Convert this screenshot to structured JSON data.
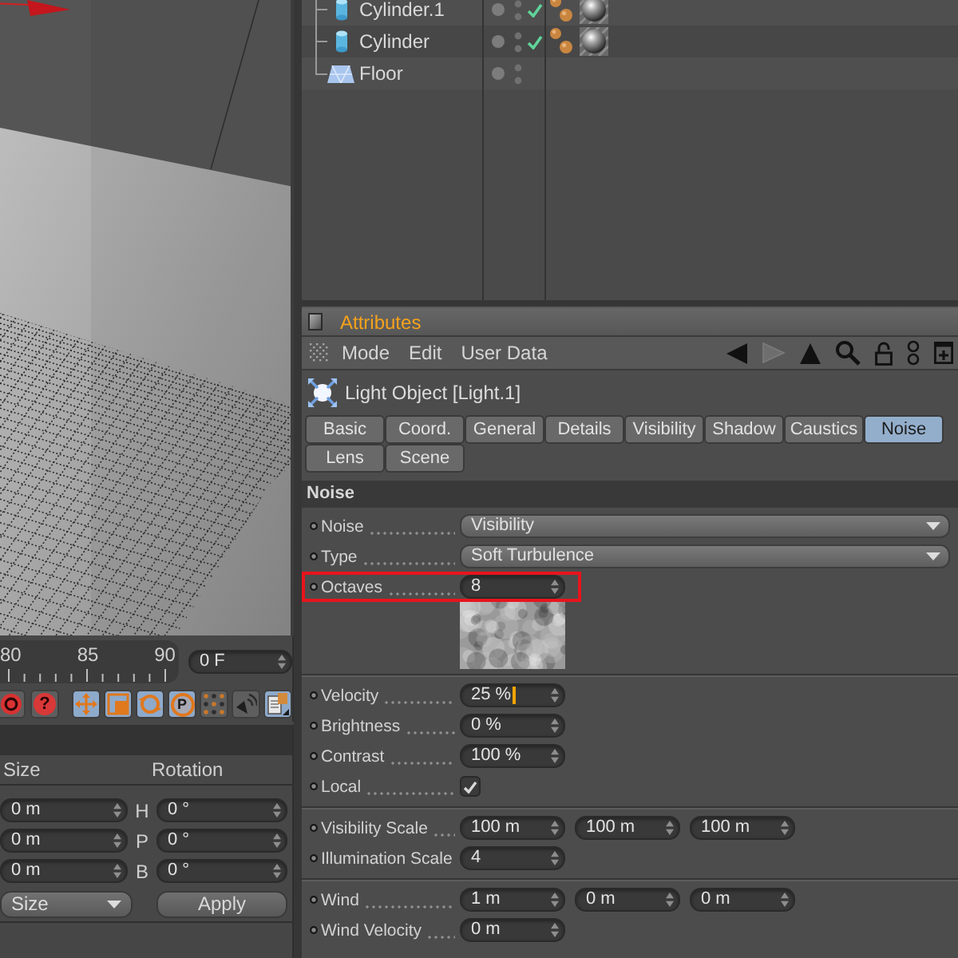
{
  "timeline": {
    "ticks": [
      "80",
      "85",
      "90"
    ],
    "frame_field": "0 F"
  },
  "toolbar": [
    {
      "kind": "ring",
      "on": false
    },
    {
      "kind": "help",
      "glyph": "?",
      "on": false
    },
    {
      "kind": "move",
      "on": true
    },
    {
      "kind": "scale",
      "on": true
    },
    {
      "kind": "rotate",
      "on": true
    },
    {
      "kind": "point",
      "glyph": "P",
      "on": true
    },
    {
      "kind": "dots",
      "on": false
    },
    {
      "kind": "speaker",
      "on": false
    },
    {
      "kind": "document",
      "on": true
    }
  ],
  "coordinates": {
    "columns": [
      "Size",
      "Rotation"
    ],
    "rows": [
      {
        "size": "0 m",
        "axis": "H",
        "rotation": "0 °"
      },
      {
        "size": "0 m",
        "axis": "P",
        "rotation": "0 °"
      },
      {
        "size": "0 m",
        "axis": "B",
        "rotation": "0 °"
      }
    ],
    "mode_dropdown": "Size",
    "apply_button": "Apply"
  },
  "object_manager": {
    "objects": [
      {
        "name": "Cylinder.1",
        "kind": "cylinder",
        "enabled": true,
        "tags": [
          {
            "kind": "balls"
          },
          {
            "kind": "material"
          }
        ]
      },
      {
        "name": "Cylinder",
        "kind": "cylinder",
        "enabled": true,
        "tags": [
          {
            "kind": "balls"
          },
          {
            "kind": "material"
          }
        ]
      },
      {
        "name": "Floor",
        "kind": "floor",
        "enabled": false
      }
    ]
  },
  "attributes": {
    "title": "Attributes",
    "menu": [
      "Mode",
      "Edit",
      "User Data"
    ],
    "nav": [
      {
        "kind": "back",
        "disabled": false
      },
      {
        "kind": "forward",
        "disabled": true
      },
      {
        "kind": "up",
        "disabled": false
      },
      {
        "kind": "search",
        "disabled": false
      },
      {
        "kind": "lock",
        "disabled": false
      },
      {
        "kind": "rings",
        "disabled": false
      },
      {
        "kind": "new-window",
        "disabled": false
      }
    ],
    "object_label": "Light Object [Light.1]",
    "tabs": [
      {
        "label": "Basic",
        "selected": false
      },
      {
        "label": "Coord.",
        "selected": false
      },
      {
        "label": "General",
        "selected": false
      },
      {
        "label": "Details",
        "selected": false
      },
      {
        "label": "Visibility",
        "selected": false
      },
      {
        "label": "Shadow",
        "selected": false
      },
      {
        "label": "Caustics",
        "selected": false
      },
      {
        "label": "Noise",
        "selected": true
      },
      {
        "label": "Lens",
        "selected": false
      },
      {
        "label": "Scene",
        "selected": false
      }
    ],
    "section": "Noise",
    "groups": [
      {
        "rows": [
          {
            "kind": "dropdown",
            "label": "Noise",
            "value": "Visibility",
            "highlighted": false
          },
          {
            "kind": "dropdown",
            "label": "Type",
            "value": "Soft Turbulence",
            "highlighted": false
          },
          {
            "kind": "number",
            "label": "Octaves",
            "value": "8",
            "highlighted": true,
            "focused": false
          },
          {
            "kind": "preview",
            "highlighted": false
          }
        ]
      },
      {
        "rows": [
          {
            "kind": "number",
            "label": "Velocity",
            "value": "25 %",
            "highlighted": false,
            "focused": true
          },
          {
            "kind": "number",
            "label": "Brightness",
            "value": "0 %",
            "highlighted": false,
            "focused": false
          },
          {
            "kind": "number",
            "label": "Contrast",
            "value": "100 %",
            "highlighted": false,
            "focused": false
          },
          {
            "kind": "checkbox",
            "label": "Local",
            "checked": true,
            "highlighted": false
          }
        ]
      },
      {
        "rows": [
          {
            "kind": "vector",
            "label": "Visibility Scale",
            "values": [
              "100 m",
              "100 m",
              "100 m"
            ],
            "highlighted": false
          },
          {
            "kind": "number",
            "label": "Illumination Scale",
            "value": "4",
            "highlighted": false,
            "focused": false
          }
        ]
      },
      {
        "rows": [
          {
            "kind": "vector",
            "label": "Wind",
            "values": [
              "1 m",
              "0 m",
              "0 m"
            ],
            "highlighted": false
          },
          {
            "kind": "number",
            "label": "Wind Velocity",
            "value": "0 m",
            "highlighted": false,
            "focused": false
          }
        ]
      }
    ]
  }
}
